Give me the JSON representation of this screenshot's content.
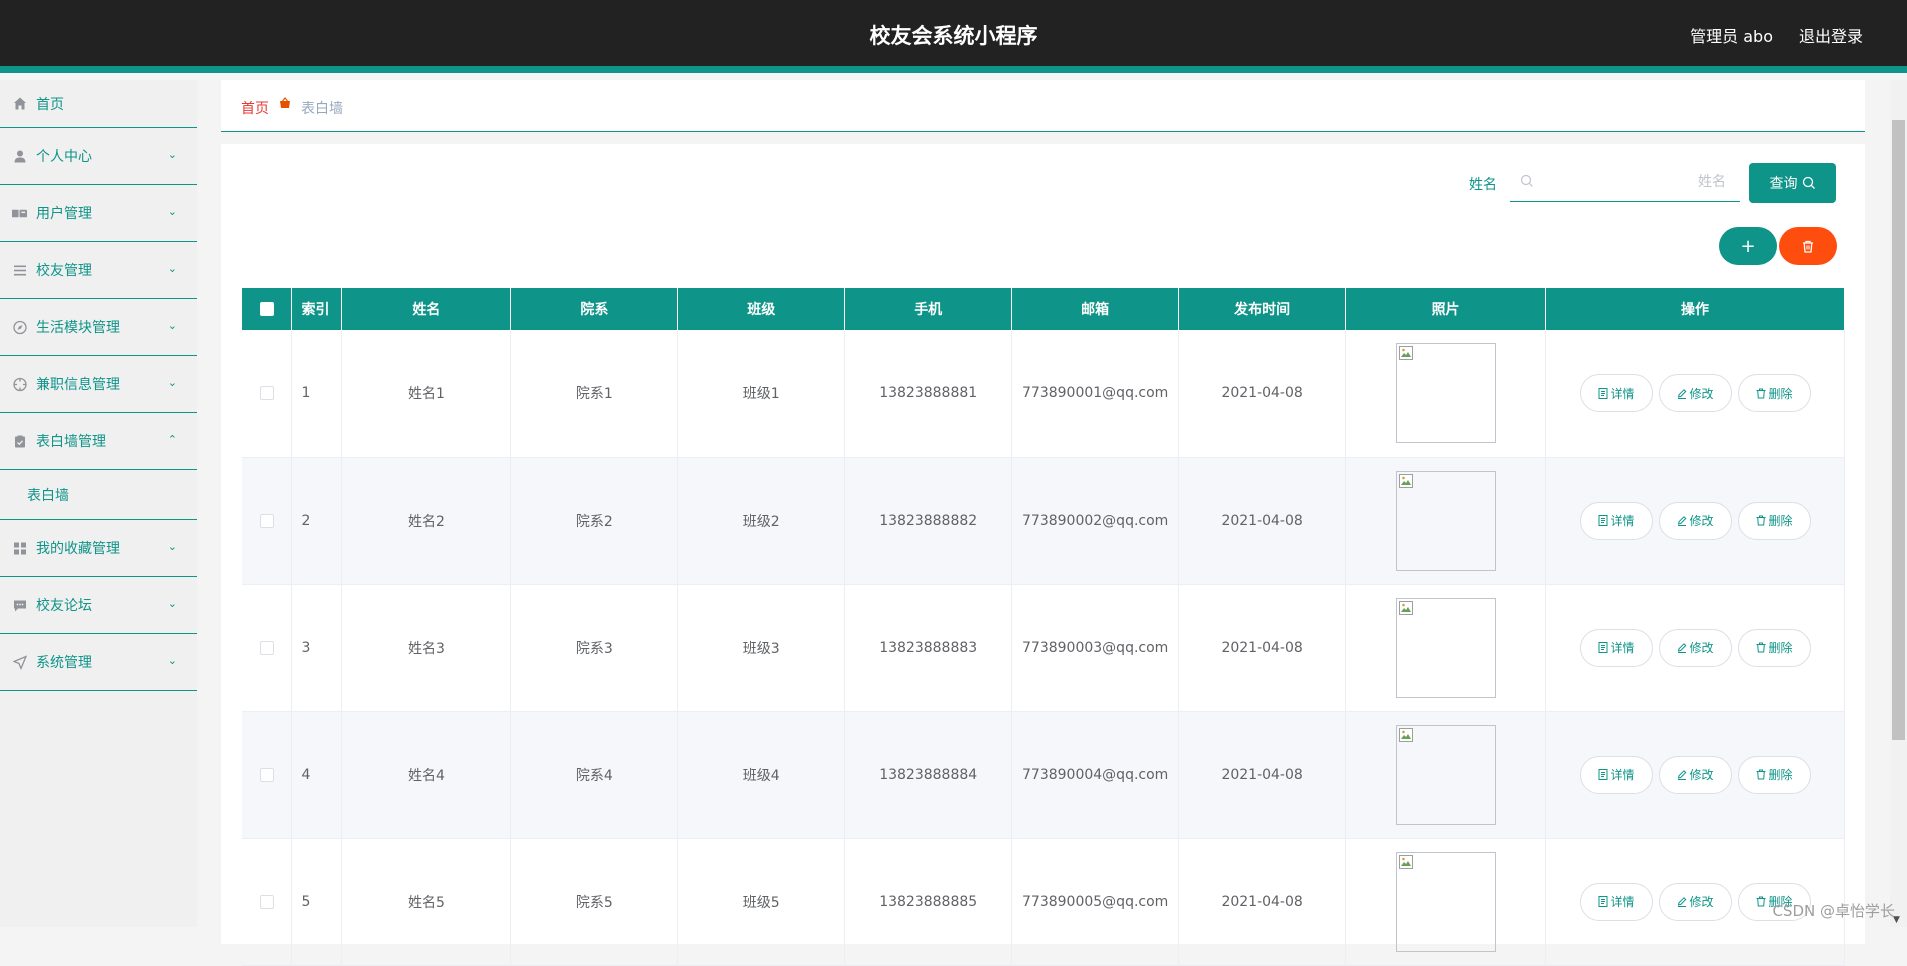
{
  "header": {
    "title": "校友会系统小程序",
    "admin": "管理员 abo",
    "logout": "退出登录"
  },
  "sidebar": {
    "items": [
      {
        "label": "首页",
        "icon": "home-icon"
      },
      {
        "label": "个人中心",
        "icon": "user-icon"
      },
      {
        "label": "用户管理",
        "icon": "users-icon"
      },
      {
        "label": "校友管理",
        "icon": "list-icon"
      },
      {
        "label": "生活模块管理",
        "icon": "compass-icon"
      },
      {
        "label": "兼职信息管理",
        "icon": "target-icon"
      },
      {
        "label": "表白墙管理",
        "icon": "clipboard-icon",
        "expanded": true
      },
      {
        "label": "我的收藏管理",
        "icon": "grid-icon"
      },
      {
        "label": "校友论坛",
        "icon": "chat-icon"
      },
      {
        "label": "系统管理",
        "icon": "send-icon"
      }
    ],
    "submenu": {
      "label": "表白墙"
    }
  },
  "breadcrumb": {
    "home": "首页",
    "current": "表白墙"
  },
  "search": {
    "label": "姓名",
    "placeholder": "姓名",
    "query_label": "查询"
  },
  "actions": {
    "add": "+"
  },
  "table": {
    "headers": [
      "索引",
      "姓名",
      "院系",
      "班级",
      "手机",
      "邮箱",
      "发布时间",
      "照片",
      "操作"
    ],
    "op_labels": {
      "detail": "详情",
      "edit": "修改",
      "delete": "删除"
    },
    "rows": [
      {
        "index": "1",
        "name": "姓名1",
        "dept": "院系1",
        "class": "班级1",
        "phone": "13823888881",
        "email": "773890001@qq.com",
        "date": "2021-04-08"
      },
      {
        "index": "2",
        "name": "姓名2",
        "dept": "院系2",
        "class": "班级2",
        "phone": "13823888882",
        "email": "773890002@qq.com",
        "date": "2021-04-08"
      },
      {
        "index": "3",
        "name": "姓名3",
        "dept": "院系3",
        "class": "班级3",
        "phone": "13823888883",
        "email": "773890003@qq.com",
        "date": "2021-04-08"
      },
      {
        "index": "4",
        "name": "姓名4",
        "dept": "院系4",
        "class": "班级4",
        "phone": "13823888884",
        "email": "773890004@qq.com",
        "date": "2021-04-08"
      },
      {
        "index": "5",
        "name": "姓名5",
        "dept": "院系5",
        "class": "班级5",
        "phone": "13823888885",
        "email": "773890005@qq.com",
        "date": "2021-04-08"
      }
    ]
  },
  "watermark": "CSDN @卓怡学长",
  "colors": {
    "accent": "#0e9488",
    "danger": "#ff4d0d",
    "header_bg": "#222222"
  }
}
